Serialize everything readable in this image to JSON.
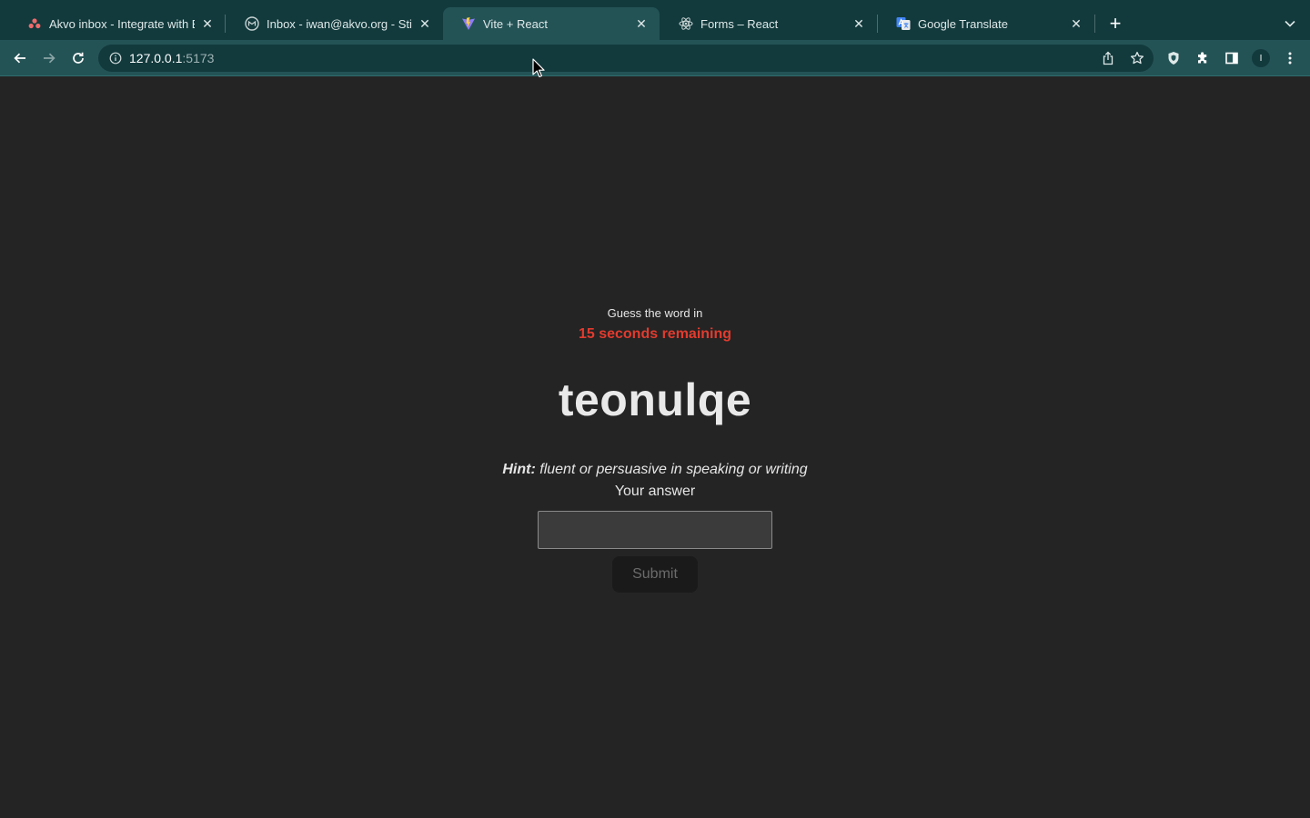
{
  "browser": {
    "tabs": [
      {
        "title": "Akvo inbox - Integrate with BE",
        "favicon": "asana-icon",
        "active": false
      },
      {
        "title": "Inbox - iwan@akvo.org - Stich",
        "favicon": "gmail-icon",
        "active": false
      },
      {
        "title": "Vite + React",
        "favicon": "vite-icon",
        "active": true
      },
      {
        "title": "Forms – React",
        "favicon": "react-icon",
        "active": false
      },
      {
        "title": "Google Translate",
        "favicon": "google-translate-icon",
        "active": false
      }
    ],
    "close_glyph": "✕",
    "new_tab_glyph": "+",
    "url": {
      "host": "127.0.0.1",
      "port": ":5173"
    },
    "profile_initial": "I"
  },
  "game": {
    "prompt": "Guess the word in",
    "timer": "15 seconds remaining",
    "scrambled_word": "teonulqe",
    "hint_label": "Hint:",
    "hint_text": "fluent or persuasive in speaking or writing",
    "answer_label": "Your answer",
    "answer_value": "",
    "submit_label": "Submit"
  },
  "colors": {
    "tabstrip_bg": "#123a3d",
    "toolbar_bg": "#245356",
    "page_bg": "#242424",
    "timer_red": "#e23b2e"
  }
}
